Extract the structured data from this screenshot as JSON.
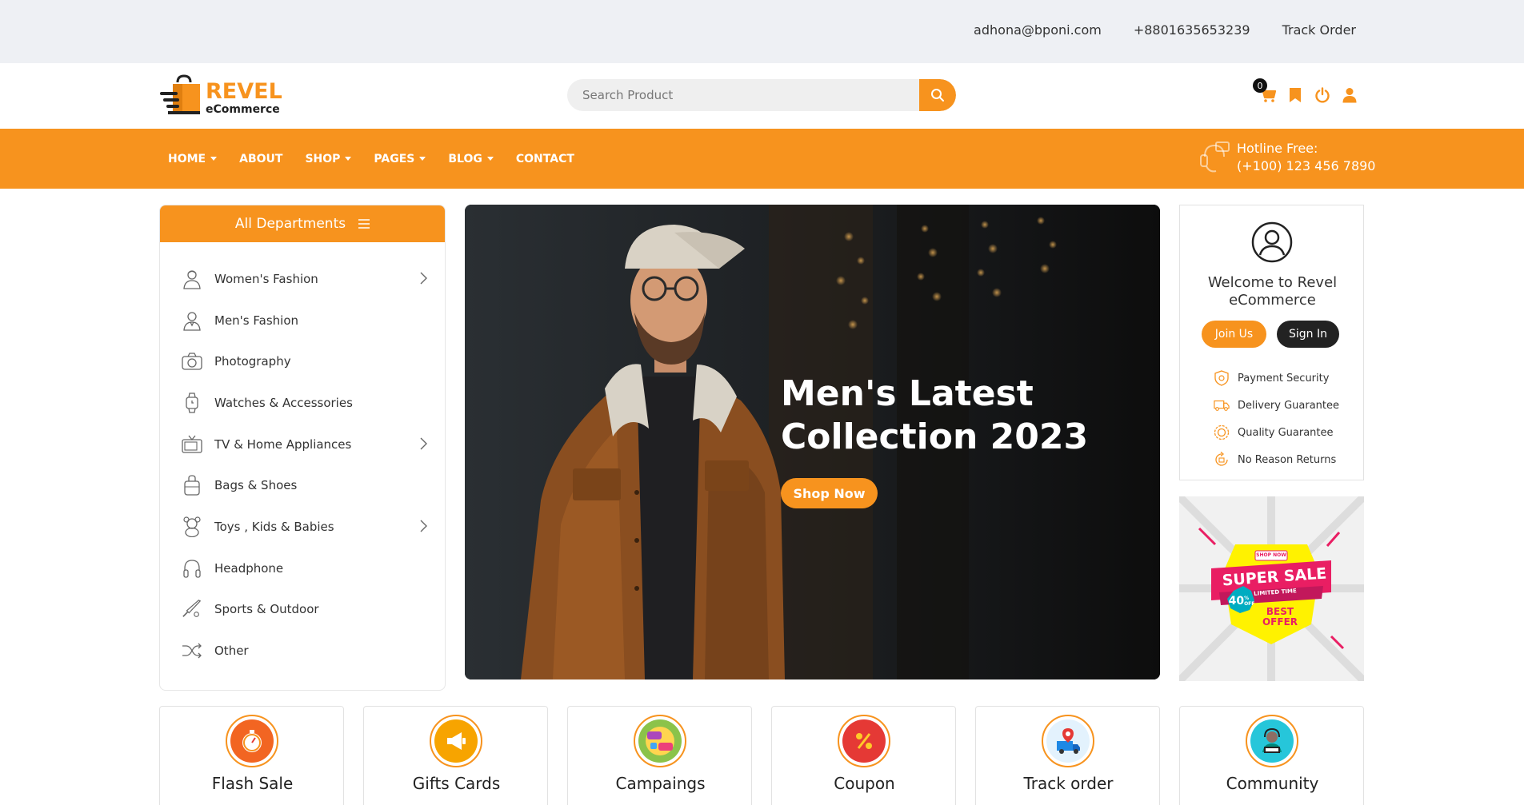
{
  "topbar": {
    "email": "adhona@bponi.com",
    "phone": "+8801635653239",
    "track_order": "Track Order"
  },
  "header": {
    "logo_word1": "REVEL",
    "logo_word2": "eCommerce",
    "search_placeholder": "Search Product",
    "cart_count": "0"
  },
  "nav": {
    "items": [
      {
        "label": "HOME",
        "dropdown": true
      },
      {
        "label": "ABOUT",
        "dropdown": false
      },
      {
        "label": "SHOP",
        "dropdown": true
      },
      {
        "label": "PAGES",
        "dropdown": true
      },
      {
        "label": "BLOG",
        "dropdown": true
      },
      {
        "label": "CONTACT",
        "dropdown": false
      }
    ],
    "hotline_label": "Hotline Free:",
    "hotline_number": "(+100) 123 456 7890"
  },
  "departments": {
    "title": "All Departments",
    "items": [
      {
        "label": "Women's Fashion",
        "icon": "woman-icon",
        "submenu": true
      },
      {
        "label": "Men's Fashion",
        "icon": "man-icon",
        "submenu": false
      },
      {
        "label": "Photography",
        "icon": "camera-icon",
        "submenu": false
      },
      {
        "label": "Watches & Accessories",
        "icon": "watch-icon",
        "submenu": false
      },
      {
        "label": "TV & Home Appliances",
        "icon": "tv-icon",
        "submenu": true
      },
      {
        "label": "Bags & Shoes",
        "icon": "bag-icon",
        "submenu": false
      },
      {
        "label": "Toys , Kids & Babies",
        "icon": "teddy-bear-icon",
        "submenu": true
      },
      {
        "label": "Headphone",
        "icon": "headphone-icon",
        "submenu": false
      },
      {
        "label": "Sports & Outdoor",
        "icon": "bat-icon",
        "submenu": false
      },
      {
        "label": "Other",
        "icon": "shuffle-icon",
        "submenu": false
      }
    ]
  },
  "hero": {
    "title_line1": "Men's Latest",
    "title_line2": "Collection 2023",
    "button": "Shop Now"
  },
  "welcome": {
    "title_line1": "Welcome to Revel",
    "title_line2": "eCommerce",
    "join": "Join Us",
    "signin": "Sign In",
    "features": [
      {
        "label": "Payment Security",
        "icon": "shield-icon"
      },
      {
        "label": "Delivery Guarantee",
        "icon": "truck-icon"
      },
      {
        "label": "Quality Guarantee",
        "icon": "badge-icon"
      },
      {
        "label": "No Reason Returns",
        "icon": "return-icon"
      }
    ]
  },
  "sale_banner": {
    "tag": "SHOP NOW",
    "title": "SUPER SALE",
    "sub": "LIMITED TIME",
    "percent": "40",
    "percent_sign": "%",
    "off": "OFF",
    "best": "BEST",
    "offer": "OFFER"
  },
  "categories": [
    {
      "label": "Flash Sale",
      "icon": "stopwatch-icon",
      "color": "#f26522"
    },
    {
      "label": "Gifts Cards",
      "icon": "megaphone-icon",
      "color": "#f7a400"
    },
    {
      "label": "Campaings",
      "icon": "campaign-icon",
      "color": "#8bc34a"
    },
    {
      "label": "Coupon",
      "icon": "percent-icon",
      "color": "#e53935"
    },
    {
      "label": "Track order",
      "icon": "delivery-icon",
      "color": "#1e88e5"
    },
    {
      "label": "Community",
      "icon": "help-desk-icon",
      "color": "#26c6da"
    }
  ],
  "colors": {
    "accent": "#f7931e",
    "dark_button": "#222222"
  }
}
